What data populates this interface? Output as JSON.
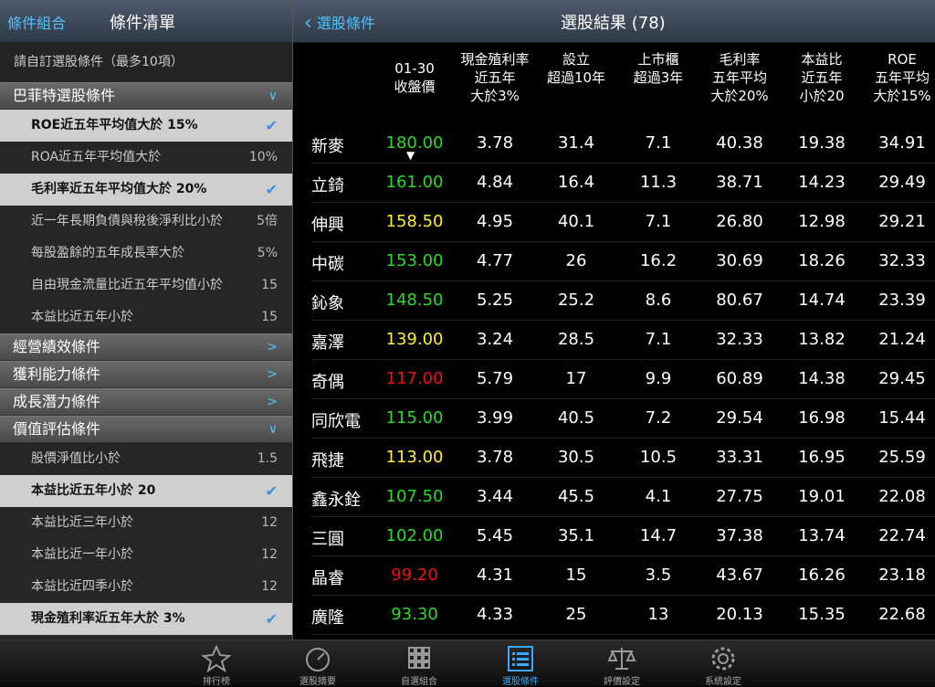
{
  "left_header": {
    "back_label": "條件組合",
    "title": "條件清單"
  },
  "right_header": {
    "back_label": "選股條件",
    "title": "選股結果 (78)"
  },
  "hint": "請自訂選股條件（最多10項）",
  "left_rows": [
    {
      "type": "section",
      "label": "巴菲特選股條件",
      "arrow": "∨"
    },
    {
      "type": "selected",
      "label": "ROE近五年平均值大於 15%"
    },
    {
      "type": "plain",
      "label": "ROA近五年平均值大於",
      "value": "10%"
    },
    {
      "type": "selected",
      "label": "毛利率近五年平均值大於 20%"
    },
    {
      "type": "plain",
      "label": "近一年長期負債與稅後淨利比小於",
      "value": "5倍"
    },
    {
      "type": "plain",
      "label": "每股盈餘的五年成長率大於",
      "value": "5%"
    },
    {
      "type": "plain",
      "label": "自由現金流量比近五年平均值小於",
      "value": "15"
    },
    {
      "type": "plain",
      "label": "本益比近五年小於",
      "value": "15"
    },
    {
      "type": "section",
      "label": "經營績效條件",
      "arrow": ">"
    },
    {
      "type": "section",
      "label": "獲利能力條件",
      "arrow": ">"
    },
    {
      "type": "section",
      "label": "成長潛力條件",
      "arrow": ">"
    },
    {
      "type": "section",
      "label": "價值評估條件",
      "arrow": "∨"
    },
    {
      "type": "plain",
      "label": "股價淨值比小於",
      "value": "1.5"
    },
    {
      "type": "selected",
      "label": "本益比近五年小於 20"
    },
    {
      "type": "plain",
      "label": "本益比近三年小於",
      "value": "12"
    },
    {
      "type": "plain",
      "label": "本益比近一年小於",
      "value": "12"
    },
    {
      "type": "plain",
      "label": "本益比近四季小於",
      "value": "12"
    },
    {
      "type": "selected",
      "label": "現金殖利率近五年大於 3%"
    }
  ],
  "columns": [
    [
      "01-30",
      "收盤價"
    ],
    [
      "現金殖利率",
      "近五年",
      "大於3%"
    ],
    [
      "設立",
      "超過10年"
    ],
    [
      "上市櫃",
      "超過3年"
    ],
    [
      "毛利率",
      "五年平均",
      "大於20%"
    ],
    [
      "本益比",
      "近五年",
      "小於20"
    ],
    [
      "ROE",
      "五年平均",
      "大於15%"
    ]
  ],
  "sort_indicator": "▼",
  "rows": [
    {
      "name": "新麥",
      "price": "180.00",
      "price_color": "#22dd22",
      "c1": "3.78",
      "c2": "31.4",
      "c3": "7.1",
      "c4": "40.38",
      "c5": "19.38",
      "c6": "34.91"
    },
    {
      "name": "立錡",
      "price": "161.00",
      "price_color": "#22dd22",
      "c1": "4.84",
      "c2": "16.4",
      "c3": "11.3",
      "c4": "38.71",
      "c5": "14.23",
      "c6": "29.49"
    },
    {
      "name": "伸興",
      "price": "158.50",
      "price_color": "#ffee22",
      "c1": "4.95",
      "c2": "40.1",
      "c3": "7.1",
      "c4": "26.80",
      "c5": "12.98",
      "c6": "29.21"
    },
    {
      "name": "中碳",
      "price": "153.00",
      "price_color": "#22dd22",
      "c1": "4.77",
      "c2": "26",
      "c3": "16.2",
      "c4": "30.69",
      "c5": "18.26",
      "c6": "32.33"
    },
    {
      "name": "鈊象",
      "price": "148.50",
      "price_color": "#22dd22",
      "c1": "5.25",
      "c2": "25.2",
      "c3": "8.6",
      "c4": "80.67",
      "c5": "14.74",
      "c6": "23.39"
    },
    {
      "name": "嘉澤",
      "price": "139.00",
      "price_color": "#ffee22",
      "c1": "3.24",
      "c2": "28.5",
      "c3": "7.1",
      "c4": "32.33",
      "c5": "13.82",
      "c6": "21.24"
    },
    {
      "name": "奇偶",
      "price": "117.00",
      "price_color": "#ee1111",
      "c1": "5.79",
      "c2": "17",
      "c3": "9.9",
      "c4": "60.89",
      "c5": "14.38",
      "c6": "29.45"
    },
    {
      "name": "同欣電",
      "price": "115.00",
      "price_color": "#22dd22",
      "c1": "3.99",
      "c2": "40.5",
      "c3": "7.2",
      "c4": "29.54",
      "c5": "16.98",
      "c6": "15.44"
    },
    {
      "name": "飛捷",
      "price": "113.00",
      "price_color": "#ffee22",
      "c1": "3.78",
      "c2": "30.5",
      "c3": "10.5",
      "c4": "33.31",
      "c5": "16.95",
      "c6": "25.59"
    },
    {
      "name": "鑫永銓",
      "price": "107.50",
      "price_color": "#22dd22",
      "c1": "3.44",
      "c2": "45.5",
      "c3": "4.1",
      "c4": "27.75",
      "c5": "19.01",
      "c6": "22.08"
    },
    {
      "name": "三圓",
      "price": "102.00",
      "price_color": "#22dd22",
      "c1": "5.45",
      "c2": "35.1",
      "c3": "14.7",
      "c4": "37.38",
      "c5": "13.74",
      "c6": "22.74"
    },
    {
      "name": "晶睿",
      "price": "99.20",
      "price_color": "#ee1111",
      "c1": "4.31",
      "c2": "15",
      "c3": "3.5",
      "c4": "43.67",
      "c5": "16.26",
      "c6": "23.18"
    },
    {
      "name": "廣隆",
      "price": "93.30",
      "price_color": "#22dd22",
      "c1": "4.33",
      "c2": "25",
      "c3": "13",
      "c4": "20.13",
      "c5": "15.35",
      "c6": "22.68"
    }
  ],
  "tabs": [
    {
      "label": "排行榜",
      "icon": "star-icon",
      "active": false
    },
    {
      "label": "選股摘要",
      "icon": "gauge-icon",
      "active": false
    },
    {
      "label": "自選組合",
      "icon": "grid-icon",
      "active": false
    },
    {
      "label": "選股條件",
      "icon": "list-icon",
      "active": true
    },
    {
      "label": "評價設定",
      "icon": "scale-icon",
      "active": false
    },
    {
      "label": "系統設定",
      "icon": "gear-icon",
      "active": false
    }
  ]
}
